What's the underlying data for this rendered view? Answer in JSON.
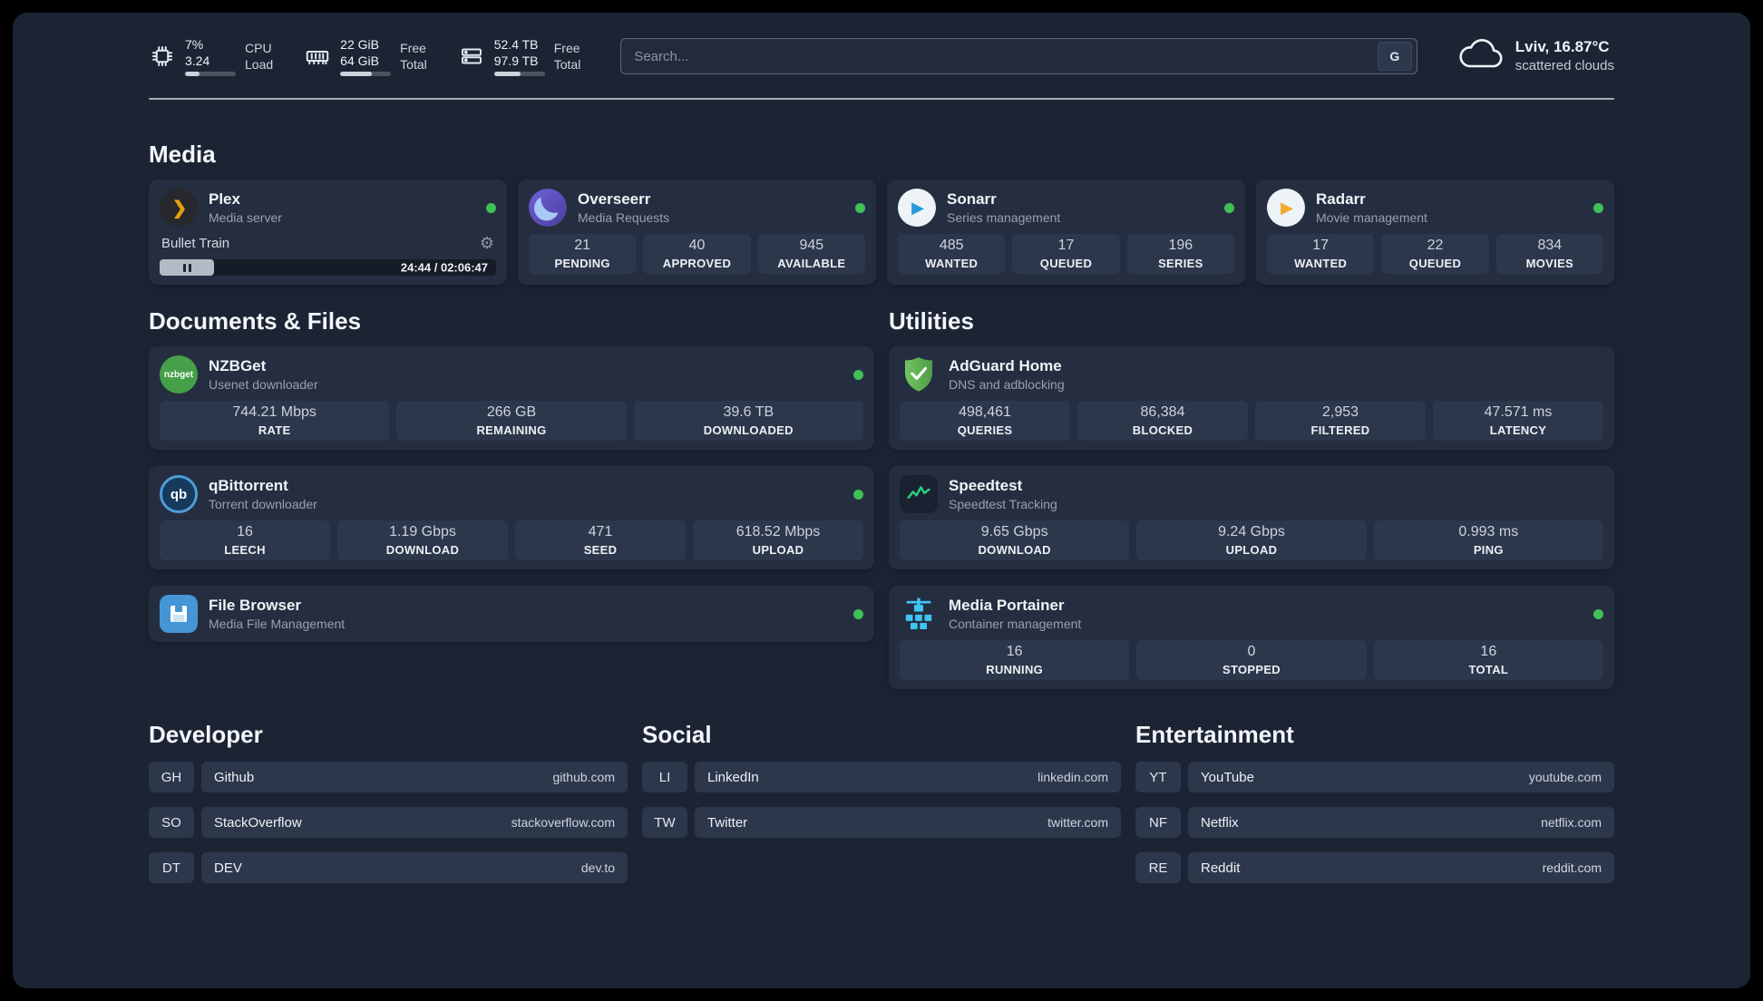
{
  "topbar": {
    "cpu": {
      "value_top": "7%",
      "value_bottom": "3.24",
      "label_top": "CPU",
      "label_bottom": "Load"
    },
    "ram": {
      "value_top": "22 GiB",
      "value_bottom": "64 GiB",
      "label_top": "Free",
      "label_bottom": "Total"
    },
    "disk": {
      "value_top": "52.4 TB",
      "value_bottom": "97.9 TB",
      "label_top": "Free",
      "label_bottom": "Total"
    },
    "search": {
      "placeholder": "Search...",
      "engine_label": "G"
    },
    "weather": {
      "location": "Lviv, 16.87°C",
      "condition": "scattered clouds"
    }
  },
  "icons": {
    "gear": "⚙"
  },
  "colors": {
    "background": "#1c2434",
    "card": "#252e40",
    "tile": "#2d374b",
    "status_online": "#40c057",
    "plex_gold": "#e5a00d",
    "radarr_gold": "#f0a92e",
    "sonarr_blue": "#2699d6",
    "adguard_green": "#5fae57",
    "portainer_blue": "#3ec6f4"
  },
  "media": {
    "title": "Media",
    "plex": {
      "name": "Plex",
      "subtitle": "Media server",
      "now_playing": "Bullet Train",
      "time": "24:44 / 02:06:47"
    },
    "overseerr": {
      "name": "Overseerr",
      "subtitle": "Media Requests",
      "stats": [
        {
          "value": "21",
          "label": "PENDING"
        },
        {
          "value": "40",
          "label": "APPROVED"
        },
        {
          "value": "945",
          "label": "AVAILABLE"
        }
      ]
    },
    "sonarr": {
      "name": "Sonarr",
      "subtitle": "Series management",
      "stats": [
        {
          "value": "485",
          "label": "WANTED"
        },
        {
          "value": "17",
          "label": "QUEUED"
        },
        {
          "value": "196",
          "label": "SERIES"
        }
      ]
    },
    "radarr": {
      "name": "Radarr",
      "subtitle": "Movie management",
      "stats": [
        {
          "value": "17",
          "label": "WANTED"
        },
        {
          "value": "22",
          "label": "QUEUED"
        },
        {
          "value": "834",
          "label": "MOVIES"
        }
      ]
    }
  },
  "documents": {
    "title": "Documents & Files",
    "nzbget": {
      "name": "NZBGet",
      "subtitle": "Usenet downloader",
      "icon_text": "nzbget",
      "stats": [
        {
          "value": "744.21 Mbps",
          "label": "RATE"
        },
        {
          "value": "266 GB",
          "label": "REMAINING"
        },
        {
          "value": "39.6 TB",
          "label": "DOWNLOADED"
        }
      ]
    },
    "qbittorrent": {
      "name": "qBittorrent",
      "subtitle": "Torrent downloader",
      "icon_text": "qb",
      "stats": [
        {
          "value": "16",
          "label": "LEECH"
        },
        {
          "value": "1.19 Gbps",
          "label": "DOWNLOAD"
        },
        {
          "value": "471",
          "label": "SEED"
        },
        {
          "value": "618.52 Mbps",
          "label": "UPLOAD"
        }
      ]
    },
    "filebrowser": {
      "name": "File Browser",
      "subtitle": "Media File Management"
    }
  },
  "utilities": {
    "title": "Utilities",
    "adguard": {
      "name": "AdGuard Home",
      "subtitle": "DNS and adblocking",
      "stats": [
        {
          "value": "498,461",
          "label": "QUERIES"
        },
        {
          "value": "86,384",
          "label": "BLOCKED"
        },
        {
          "value": "2,953",
          "label": "FILTERED"
        },
        {
          "value": "47.571 ms",
          "label": "LATENCY"
        }
      ]
    },
    "speedtest": {
      "name": "Speedtest",
      "subtitle": "Speedtest Tracking",
      "stats": [
        {
          "value": "9.65 Gbps",
          "label": "DOWNLOAD"
        },
        {
          "value": "9.24 Gbps",
          "label": "UPLOAD"
        },
        {
          "value": "0.993 ms",
          "label": "PING"
        }
      ]
    },
    "portainer": {
      "name": "Media Portainer",
      "subtitle": "Container management",
      "stats": [
        {
          "value": "16",
          "label": "RUNNING"
        },
        {
          "value": "0",
          "label": "STOPPED"
        },
        {
          "value": "16",
          "label": "TOTAL"
        }
      ]
    }
  },
  "bookmarks": {
    "developer": {
      "title": "Developer",
      "items": [
        {
          "abbr": "GH",
          "name": "Github",
          "url": "github.com"
        },
        {
          "abbr": "SO",
          "name": "StackOverflow",
          "url": "stackoverflow.com"
        },
        {
          "abbr": "DT",
          "name": "DEV",
          "url": "dev.to"
        }
      ]
    },
    "social": {
      "title": "Social",
      "items": [
        {
          "abbr": "LI",
          "name": "LinkedIn",
          "url": "linkedin.com"
        },
        {
          "abbr": "TW",
          "name": "Twitter",
          "url": "twitter.com"
        }
      ]
    },
    "entertainment": {
      "title": "Entertainment",
      "items": [
        {
          "abbr": "YT",
          "name": "YouTube",
          "url": "youtube.com"
        },
        {
          "abbr": "NF",
          "name": "Netflix",
          "url": "netflix.com"
        },
        {
          "abbr": "RE",
          "name": "Reddit",
          "url": "reddit.com"
        }
      ]
    }
  }
}
